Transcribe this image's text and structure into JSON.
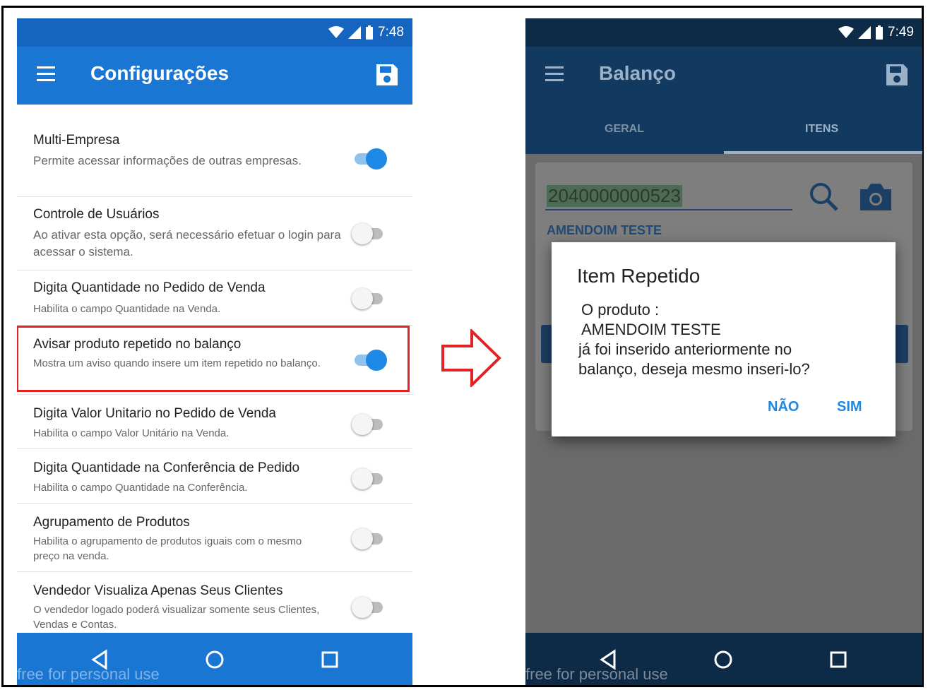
{
  "left_phone": {
    "status": {
      "time": "7:48"
    },
    "appbar": {
      "title": "Configurações"
    },
    "settings": [
      {
        "title": "Multi-Empresa",
        "description": "Permite acessar informações de outras empresas.",
        "enabled": true
      },
      {
        "title": "Controle de Usuários",
        "description": "Ao ativar esta opção, será necessário efetuar o login para acessar o sistema.",
        "enabled": false
      },
      {
        "title": "Digita Quantidade no Pedido de Venda",
        "description": "Habilita o campo Quantidade na Venda.",
        "enabled": false
      },
      {
        "title": "Avisar produto repetido no balanço",
        "description": "Mostra um aviso quando insere um item repetido no balanço.",
        "enabled": true,
        "highlighted": true
      },
      {
        "title": "Digita Valor Unitario no Pedido de Venda",
        "description": "Habilita o campo Valor Unitário na Venda.",
        "enabled": false
      },
      {
        "title": "Digita Quantidade na Conferência de Pedido",
        "description": "Habilita o campo Quantidade na Conferência.",
        "enabled": false
      },
      {
        "title": "Agrupamento de Produtos",
        "description": "Habilita o agrupamento de produtos iguais com o mesmo preço na venda.",
        "enabled": false
      },
      {
        "title": "Vendedor Visualiza Apenas Seus Clientes",
        "description": "O vendedor logado poderá visualizar somente seus Clientes, Vendas e Contas.",
        "enabled": false
      }
    ],
    "watermark": "free for personal use"
  },
  "right_phone": {
    "status": {
      "time": "7:49"
    },
    "appbar": {
      "title": "Balanço"
    },
    "tabs": [
      "GERAL",
      "ITENS"
    ],
    "barcode": "2040000000523",
    "product_name": "AMENDOIM TESTE",
    "dialog": {
      "title": "Item Repetido",
      "lines": [
        "O produto :",
        "AMENDOIM TESTE",
        "já foi inserido anteriormente no",
        "balanço, deseja mesmo inseri-lo?"
      ],
      "negative": "NÃO",
      "positive": "SIM"
    },
    "watermark": "free for personal use"
  },
  "colors": {
    "primary": "#1976d2",
    "status_bar": "#1565c0",
    "accent": "#1e88e5",
    "highlight_border": "#e02424",
    "arrow": "#e02424"
  }
}
